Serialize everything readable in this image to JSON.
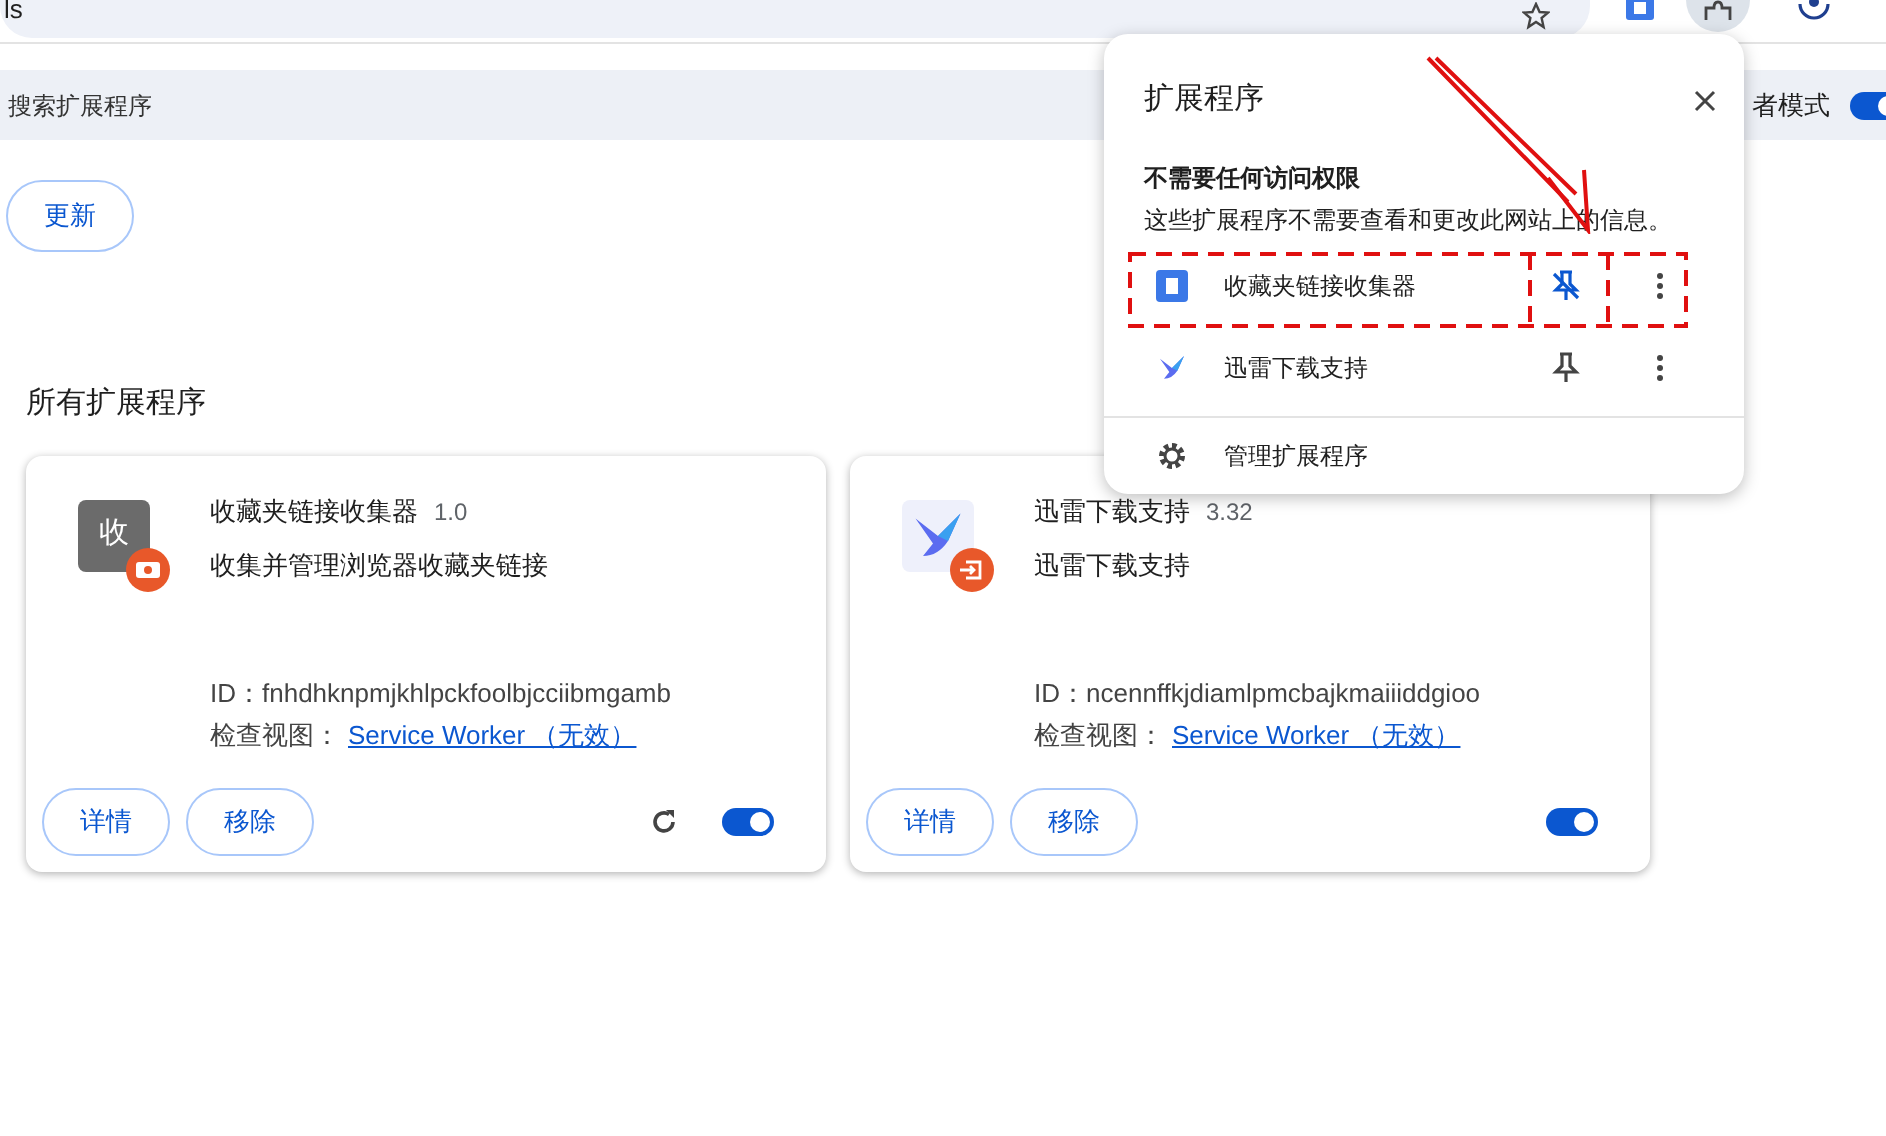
{
  "toolbar": {
    "address_text": "ls"
  },
  "search": {
    "placeholder": "搜索扩展程序"
  },
  "developer_mode": {
    "label": "者模式",
    "on": true
  },
  "update_button": "更新",
  "section_title": "所有扩展程序",
  "extensions": [
    {
      "name": "收藏夹链接收集器",
      "version": "1.0",
      "description": "收集并管理浏览器收藏夹链接",
      "icon_text": "收",
      "id_label": "ID：",
      "id": "fnhdhknpmjkhlpckfoolbjcciibmgamb",
      "inspect_label": "检查视图：",
      "inspect_link": "Service Worker （无效）",
      "details": "详情",
      "remove": "移除",
      "reload": true,
      "enabled": true,
      "kind": "letter"
    },
    {
      "name": "迅雷下载支持",
      "version": "3.32",
      "description": "迅雷下载支持",
      "id_label": "ID：",
      "id": "ncennffkjdiamlpmcbajkmaiiiddgioo",
      "inspect_label": "检查视图：",
      "inspect_link": "Service Worker （无效）",
      "details": "详情",
      "remove": "移除",
      "reload": false,
      "enabled": true,
      "kind": "bird"
    }
  ],
  "popup": {
    "title": "扩展程序",
    "section_heading": "不需要任何访问权限",
    "section_note": "这些扩展程序不需要查看和更改此网站上的信息。",
    "items": [
      {
        "name": "收藏夹链接收集器",
        "pinned": true,
        "highlighted": true,
        "kind": "square"
      },
      {
        "name": "迅雷下载支持",
        "pinned": false,
        "highlighted": false,
        "kind": "bird"
      }
    ],
    "manage": "管理扩展程序"
  }
}
